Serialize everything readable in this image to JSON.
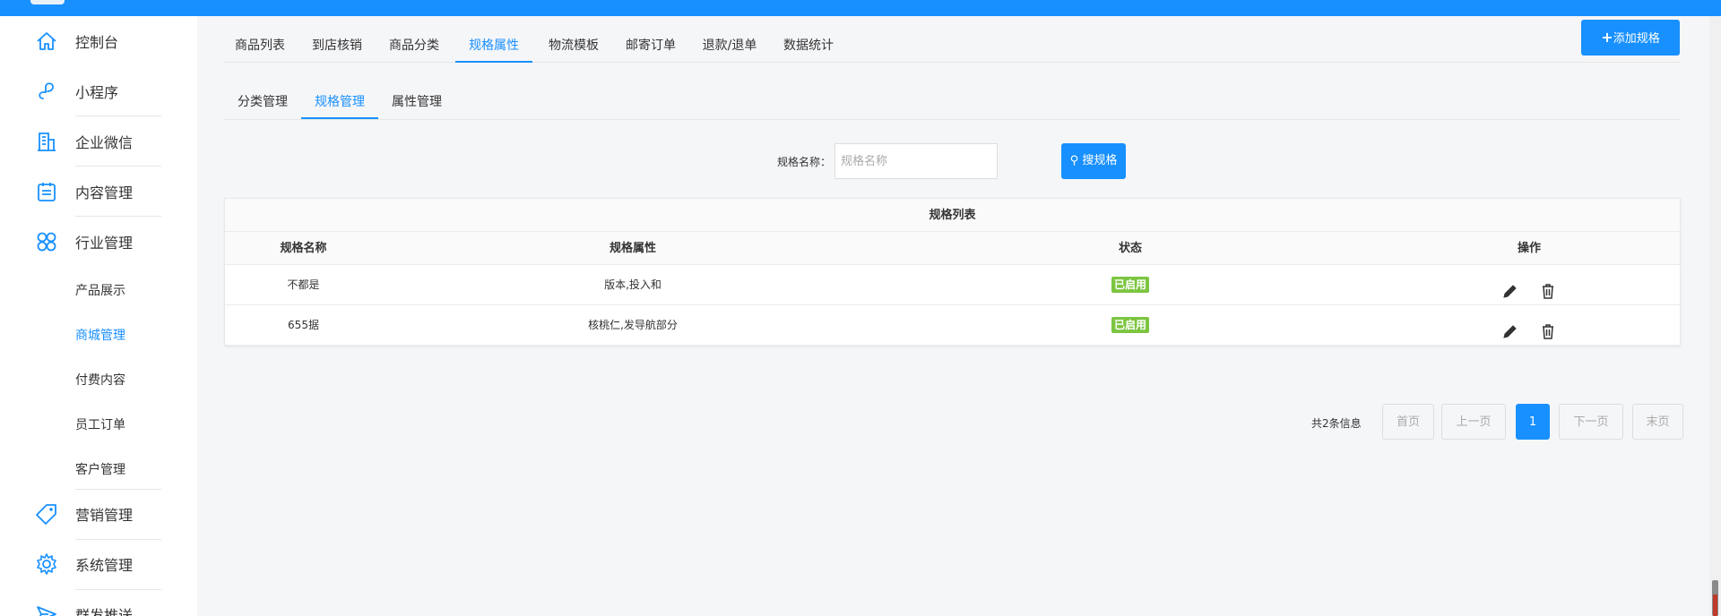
{
  "sidebar": {
    "items": [
      {
        "label": "控制台",
        "icon": "home-icon"
      },
      {
        "label": "小程序",
        "icon": "link-icon"
      },
      {
        "label": "企业微信",
        "icon": "building-icon"
      },
      {
        "label": "内容管理",
        "icon": "calendar-icon"
      },
      {
        "label": "行业管理",
        "icon": "grid-icon"
      },
      {
        "label": "营销管理",
        "icon": "tag-icon"
      },
      {
        "label": "系统管理",
        "icon": "gear-icon"
      },
      {
        "label": "群发推送",
        "icon": "send-icon"
      }
    ],
    "subitems": [
      "产品展示",
      "商城管理",
      "付费内容",
      "员工订单",
      "客户管理"
    ],
    "active_subitem": "商城管理"
  },
  "tabs": [
    "商品列表",
    "到店核销",
    "商品分类",
    "规格属性",
    "物流模板",
    "邮寄订单",
    "退款/退单",
    "数据统计"
  ],
  "active_tab": "规格属性",
  "add_button": "添加规格",
  "subtabs": [
    "分类管理",
    "规格管理",
    "属性管理"
  ],
  "active_subtab": "规格管理",
  "search": {
    "label": "规格名称：",
    "placeholder": "规格名称",
    "button": "搜规格"
  },
  "table": {
    "caption": "规格列表",
    "columns": [
      "规格名称",
      "规格属性",
      "状态",
      "操作"
    ],
    "rows": [
      {
        "name": "不都是",
        "attrs": "版本,投入和",
        "status": "已启用"
      },
      {
        "name": "655据",
        "attrs": "核桃仁,发导航部分",
        "status": "已启用"
      }
    ]
  },
  "pagination": {
    "info": "共2条信息",
    "first": "首页",
    "prev": "上一页",
    "current": "1",
    "next": "下一页",
    "last": "末页"
  },
  "colors": {
    "primary": "#1890ff",
    "success": "#7cc540"
  }
}
